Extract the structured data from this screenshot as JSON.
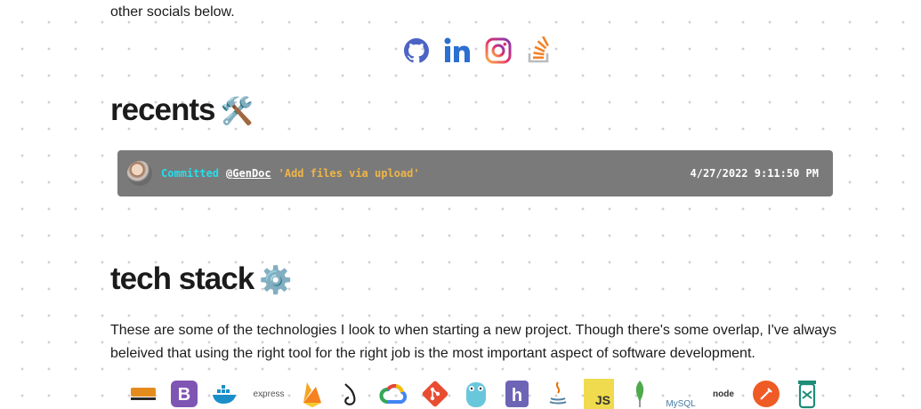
{
  "intro": {
    "text": "other socials below."
  },
  "socials": [
    {
      "name": "github",
      "color": "#4c64c4"
    },
    {
      "name": "linkedin",
      "color": "#2b6fd0"
    },
    {
      "name": "instagram",
      "color": "#e1306c"
    },
    {
      "name": "stackoverflow",
      "color": "#f48024"
    }
  ],
  "recents": {
    "heading": "recents",
    "emoji": "🛠️",
    "commit": {
      "action": "Committed",
      "at": "@",
      "user": "GenDoc",
      "message": "'Add files via upload'",
      "date": "4/27/2022 9:11:50 PM"
    }
  },
  "tech": {
    "heading": "tech stack",
    "emoji": "⚙️",
    "paragraph": "These are some of the technologies I look to when starting a new project. Though there's some overlap, I've always beleived that using the right tool for the right job is the most important aspect of software development.",
    "icons": [
      "amazon-web-services-icon",
      "bootstrap-icon",
      "docker-icon",
      "express-icon",
      "firebase-icon",
      "flask-icon",
      "google-cloud-icon",
      "git-icon",
      "go-icon",
      "heroku-icon",
      "java-icon",
      "javascript-icon",
      "mongodb-icon",
      "mysql-icon",
      "nodejs-icon",
      "postman-icon",
      "pytest-icon"
    ],
    "icon_labels": {
      "express": "express",
      "js": "JS",
      "mysql": "MySQL",
      "node": "node"
    }
  }
}
